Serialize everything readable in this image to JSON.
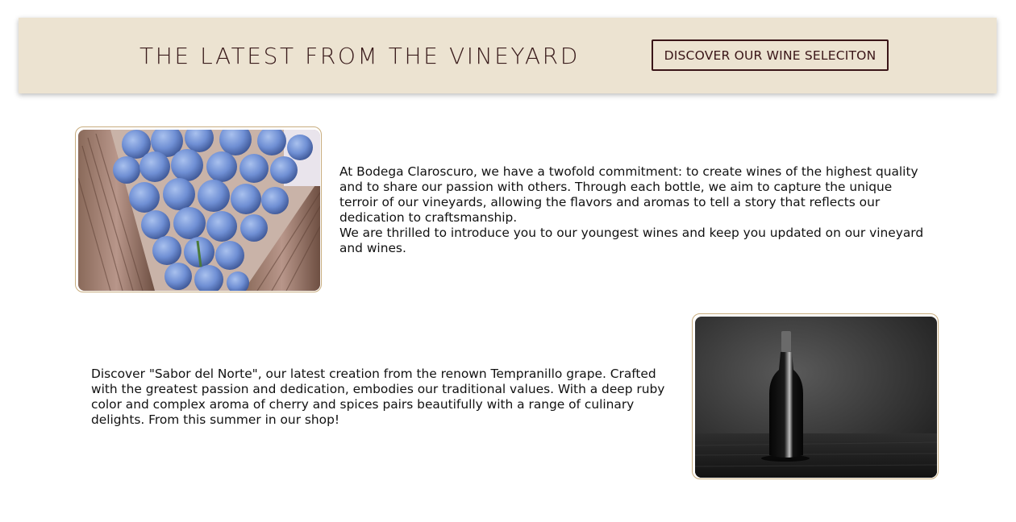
{
  "header": {
    "title": "THE LATEST FROM THE VINEYARD",
    "cta_label": "DISCOVER OUR WINE SELECITON"
  },
  "section1": {
    "image": "blue-grapes-photo",
    "paragraph_1": "At Bodega Claroscuro, we have a twofold commitment: to create wines of the highest quality and to share our passion with others. Through each bottle, we aim to capture the unique terroir of our vineyards, allowing the flavors and aromas to tell a story that reflects our dedication to craftsmanship.",
    "paragraph_2": "We are thrilled to introduce you to our youngest wines and keep you updated on our vineyard and wines."
  },
  "section2": {
    "image": "wine-bottle-photo",
    "paragraph": "Discover \"Sabor del Norte\", our latest creation from the renown Tempranillo grape. Crafted with the greatest passion and dedication, embodies our traditional values. With a deep ruby color and complex aroma of cherry and spices pairs beautifully with a range of culinary delights. From this summer in our shop!"
  },
  "colors": {
    "banner_bg": "#ece3d1",
    "title_color": "#3a1c1c",
    "button_border": "#3a1518",
    "frame_border": "#c8ad7f"
  }
}
